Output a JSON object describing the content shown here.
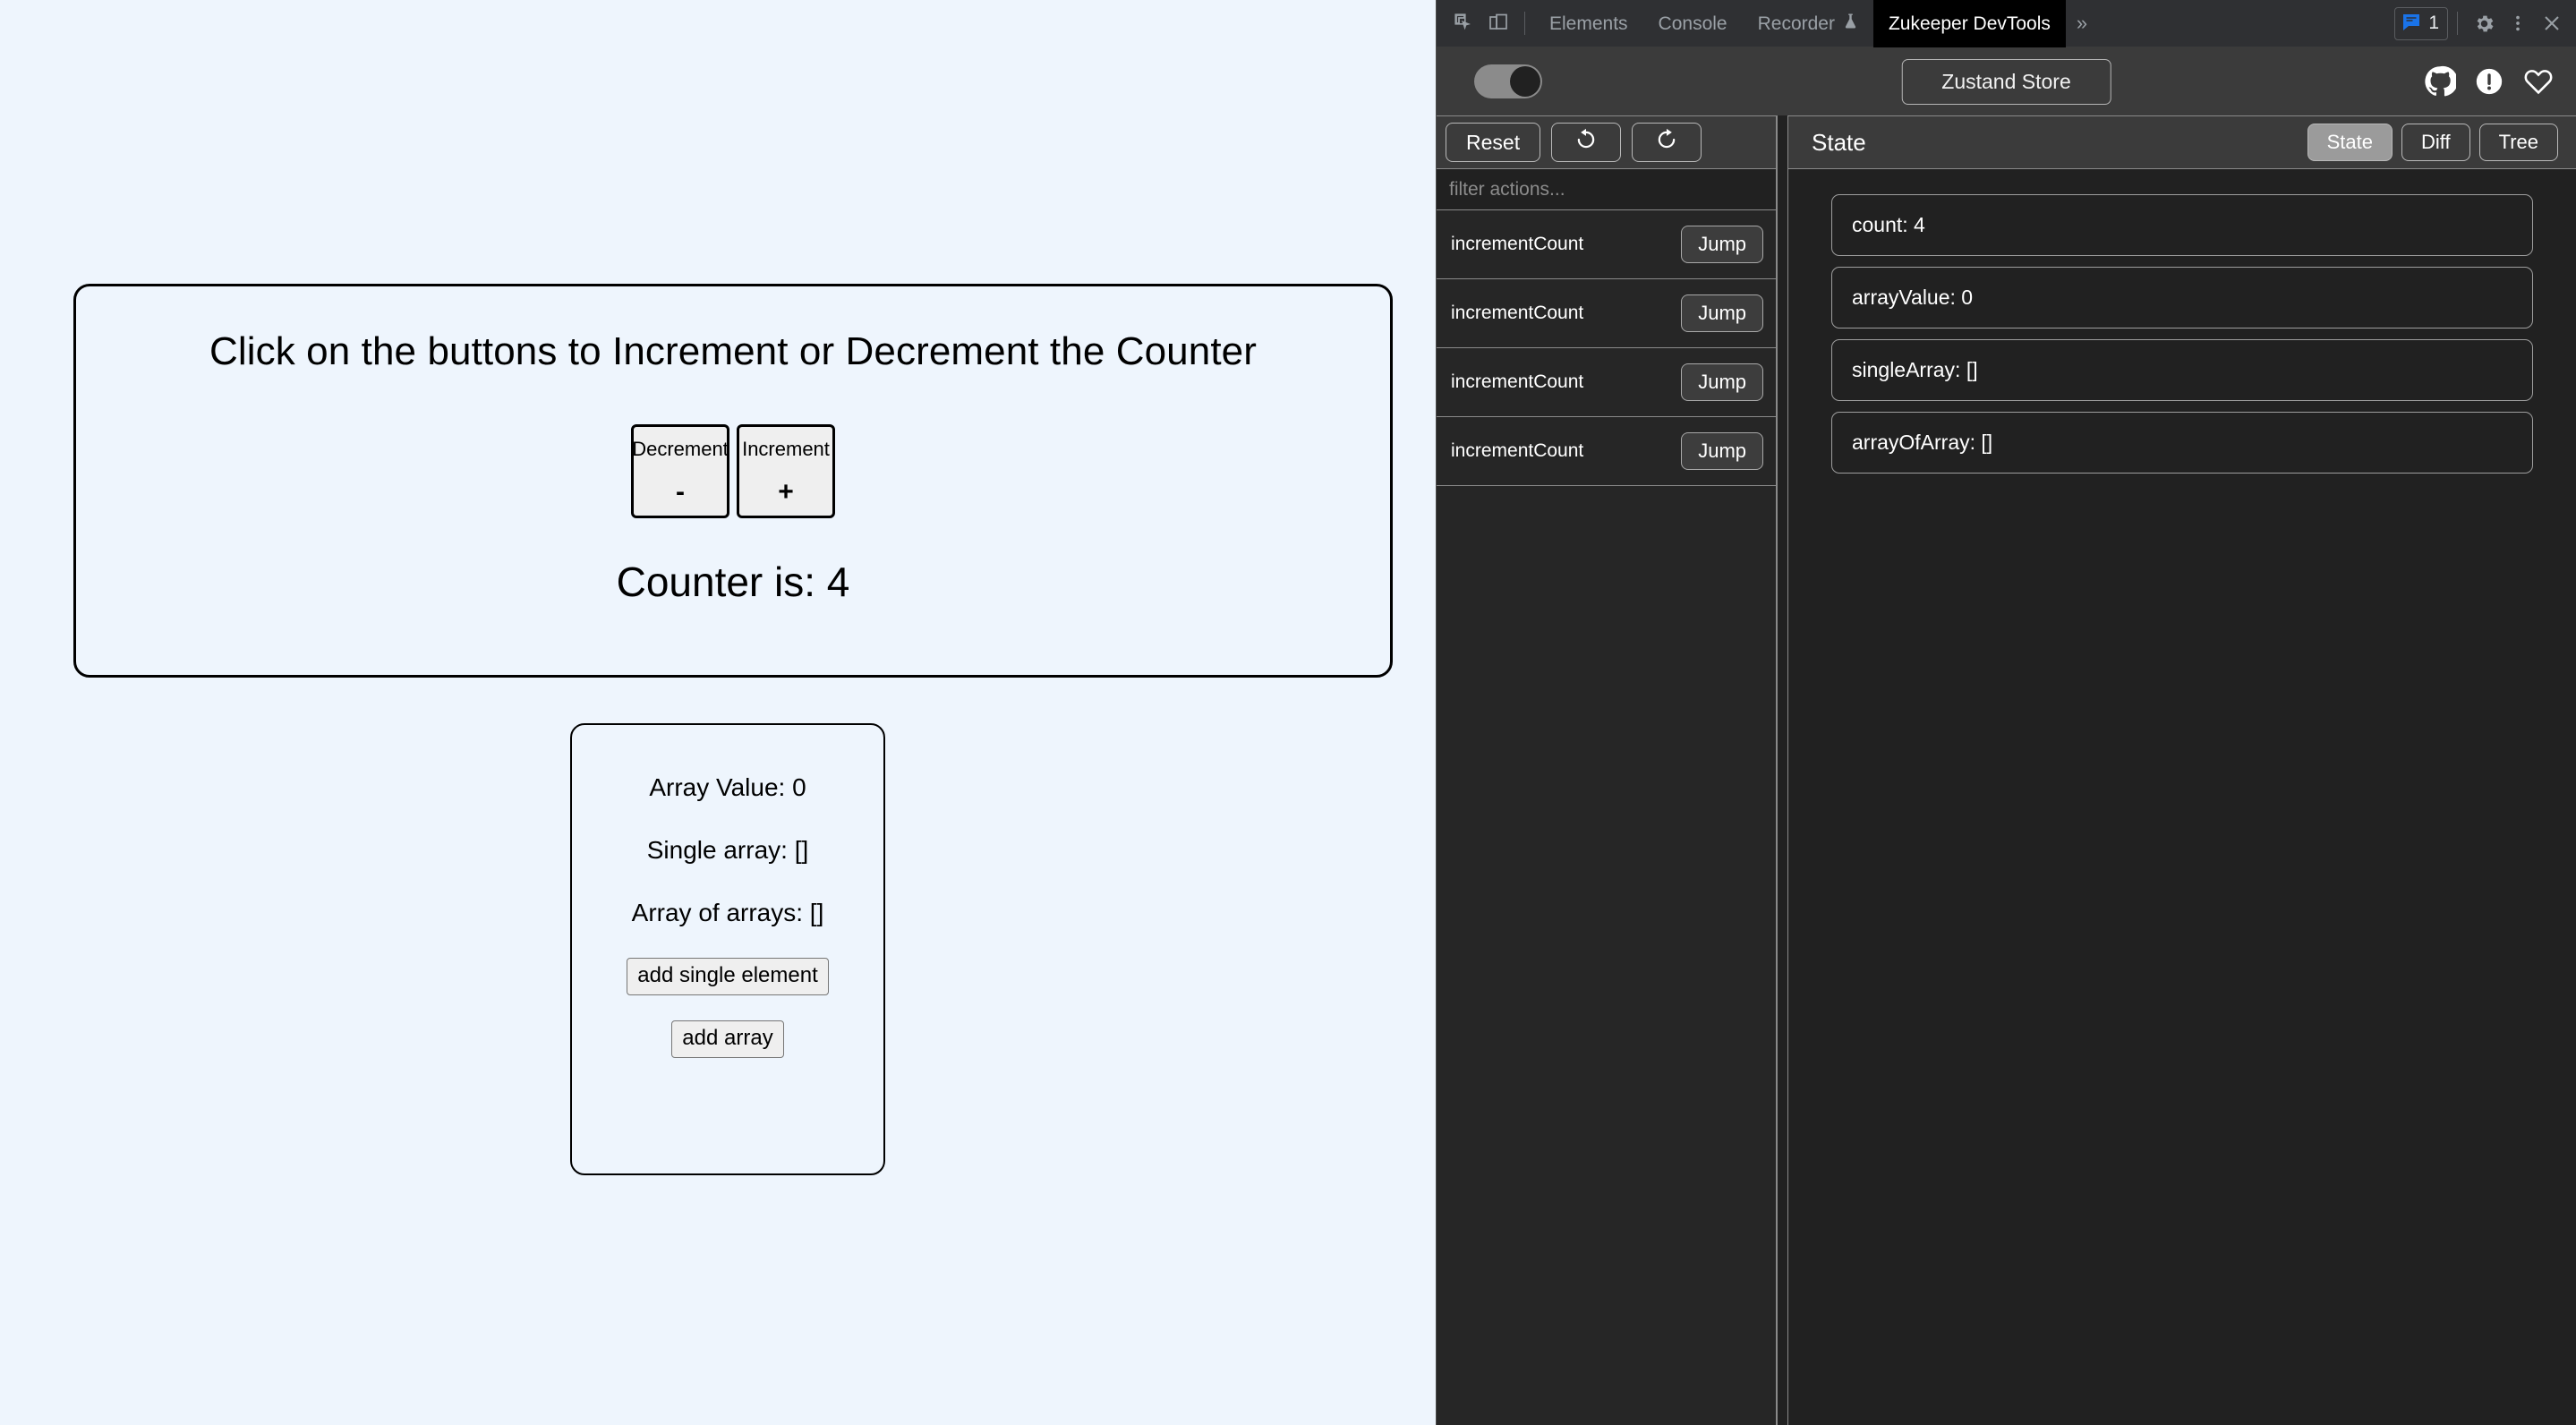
{
  "webpage": {
    "counter_card": {
      "title": "Click on the buttons to Increment or Decrement the Counter",
      "decrement_label": "Decrement",
      "decrement_symbol": "-",
      "increment_label": "Increment",
      "increment_symbol": "+",
      "counter_text": "Counter is: 4"
    },
    "array_card": {
      "array_value": "Array Value: 0",
      "single_array": "Single array: []",
      "array_of_arrays": "Array of arrays: []",
      "add_single_label": "add single element",
      "add_array_label": "add array"
    }
  },
  "devtools": {
    "tabbar": {
      "inspect_icon": "inspect-element-icon",
      "device_icon": "device-toolbar-icon",
      "tabs": [
        {
          "label": "Elements",
          "active": false,
          "icon": ""
        },
        {
          "label": "Console",
          "active": false,
          "icon": ""
        },
        {
          "label": "Recorder",
          "active": false,
          "icon": "flask-icon"
        },
        {
          "label": "Zukeeper DevTools",
          "active": true,
          "icon": ""
        }
      ],
      "more_tabs": "»",
      "issues_count": "1",
      "issues_icon": "issues-message-icon",
      "settings_icon": "gear-icon",
      "more_options_icon": "vertical-dots-icon",
      "close_icon": "close-icon"
    },
    "zukeeper_header": {
      "toggle_state": "on",
      "store_button_label": "Zustand Store",
      "icons": [
        "github-icon",
        "info-circle-icon",
        "heart-icon"
      ]
    },
    "actions_pane": {
      "reset_label": "Reset",
      "undo_icon": "undo-arrow-icon",
      "redo_icon": "redo-arrow-icon",
      "filter_placeholder": "filter actions...",
      "filter_value": "",
      "jump_label": "Jump",
      "actions": [
        {
          "name": "incrementCount"
        },
        {
          "name": "incrementCount"
        },
        {
          "name": "incrementCount"
        },
        {
          "name": "incrementCount"
        }
      ]
    },
    "state_pane": {
      "title": "State",
      "tabs": [
        {
          "label": "State",
          "active": true
        },
        {
          "label": "Diff",
          "active": false
        },
        {
          "label": "Tree",
          "active": false
        }
      ],
      "items": [
        {
          "text": "count: 4"
        },
        {
          "text": "arrayValue: 0"
        },
        {
          "text": "singleArray: []"
        },
        {
          "text": "arrayOfArray: []"
        }
      ]
    }
  },
  "colors": {
    "page_bg": "#eef5fd",
    "devtools_tabbar": "#2f3033",
    "devtools_panel": "#212121",
    "devtools_header": "#3b3b3b",
    "active_tab_bg": "#000000",
    "accent_blue": "#1a73e8",
    "muted_text": "#9aa0a6",
    "seg_active": "#9b9b9b"
  }
}
